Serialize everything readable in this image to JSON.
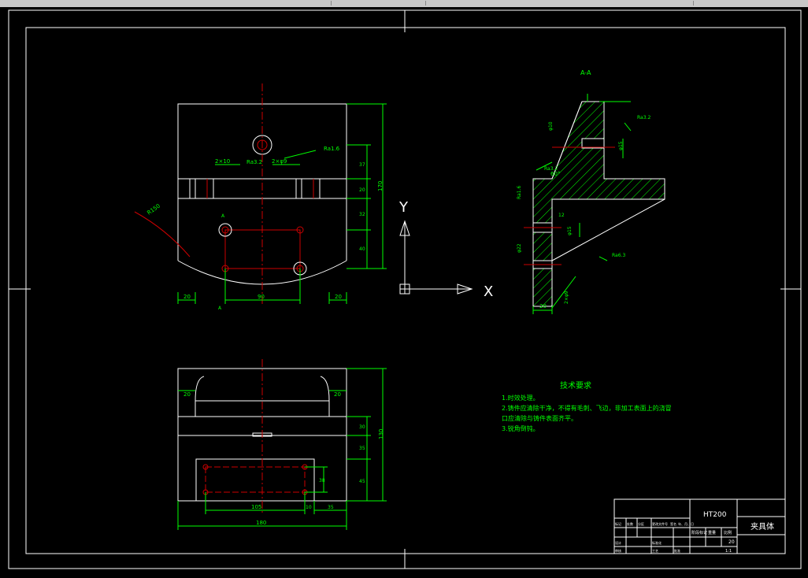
{
  "section_label": "A-A",
  "section_mark": "A",
  "axis": {
    "y_label": "Y",
    "x_label": "X"
  },
  "front_view": {
    "dims": {
      "left_gap": "20",
      "bottom_span": "90",
      "right_gap": "20",
      "height_total": "170",
      "h1": "37",
      "h2": "20",
      "h3": "32",
      "h4": "40",
      "holes_left": "2×10",
      "holes_right": "2×φ9",
      "radius": "R150"
    },
    "roughness": [
      "Ra3.2",
      "Ra1.6"
    ]
  },
  "top_view": {
    "dims": {
      "left": "20",
      "right": "20",
      "width_total": "180",
      "hole_span": "105",
      "gap": "10",
      "right_edge": "35",
      "height_total": "130",
      "h1": "30",
      "h2": "35",
      "h3": "45",
      "h4": "38"
    }
  },
  "section_view": {
    "dims": {
      "angle": "60°",
      "d1": "φ10",
      "d2": "φ15",
      "d3": "φ22",
      "d4": "φ15",
      "wall": "20",
      "holes": "2×φ9",
      "ra": "Ra1.6",
      "depth": "12",
      "spacing": "22"
    },
    "roughness": [
      "Ra3.2",
      "Ra3.2",
      "Ra6.3"
    ]
  },
  "tech_req": {
    "title": "技术要求",
    "lines": [
      "1.时效处理。",
      "2.铸件应清除干净，不得有毛刺、飞边，非加工表面上的浇冒",
      "口应清除与铸件表面齐平。",
      "3.锐角倒钝。"
    ]
  },
  "title_block": {
    "material": "HT200",
    "part_name": "夹具体",
    "scale": "1:1",
    "qty": "20",
    "stage_label": "阶段标记",
    "weight_label": "重量",
    "scale_label": "比例",
    "row_labels": [
      "标记",
      "处数",
      "分区",
      "更改文件号",
      "签名",
      "年、月、日"
    ],
    "left_labels": [
      "设计",
      "审核",
      "工艺"
    ],
    "std_label": "标准化",
    "approve_label": "批准"
  }
}
